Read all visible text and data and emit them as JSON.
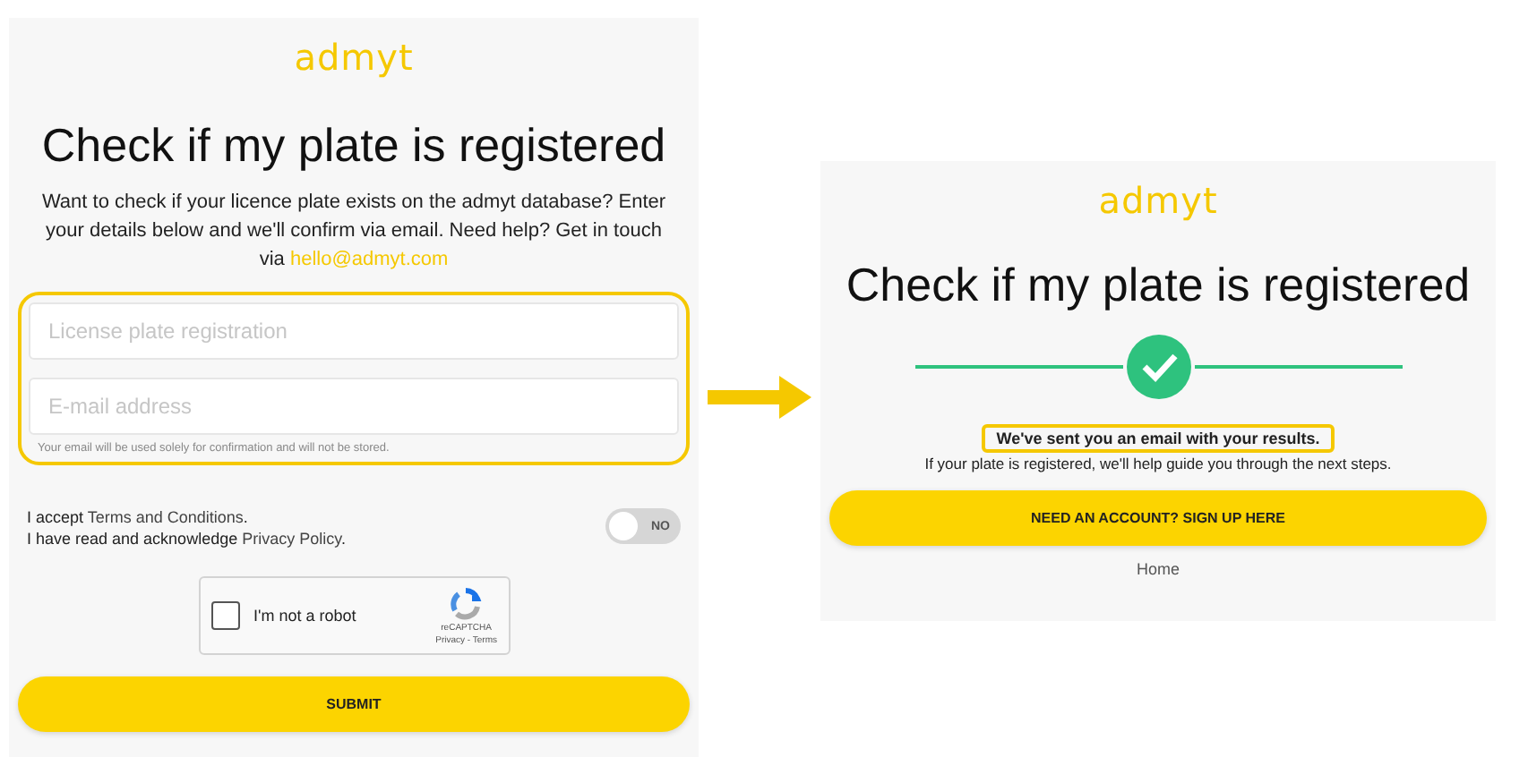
{
  "form_screen": {
    "logo": "admyt",
    "title": "Check if my plate is registered",
    "intro": "Want to check if your licence plate exists on the admyt database? Enter your details below and we'll confirm via email. Need help? Get in touch via",
    "contact_link": "hello@admyt.com",
    "fields": [
      {
        "placeholder": "License plate registration"
      },
      {
        "placeholder": "E-mail address"
      }
    ],
    "field_note": "Your email will be used solely for confirmation and will not be stored.",
    "consent": [
      {
        "prefix": "I accept",
        "link": "Terms and Conditions",
        "suffix": "."
      },
      {
        "prefix": "I have read and acknowledge",
        "link": "Privacy Policy",
        "suffix": "."
      }
    ],
    "toggle": {
      "label": "NO",
      "on": false
    },
    "captcha": {
      "label": "I'm not a robot",
      "checked": false,
      "brand": "reCAPTCHA",
      "links": "Privacy - Terms"
    },
    "submit": "SUBMIT"
  },
  "result_screen": {
    "logo": "admyt",
    "title": "Check if my plate is registered",
    "success": true,
    "message": "We've sent you an email with your results.",
    "detail": "If your plate is registered, we'll help guide you through the next steps.",
    "signup": "NEED AN ACCOUNT? SIGN UP HERE",
    "home_link": "Home"
  }
}
